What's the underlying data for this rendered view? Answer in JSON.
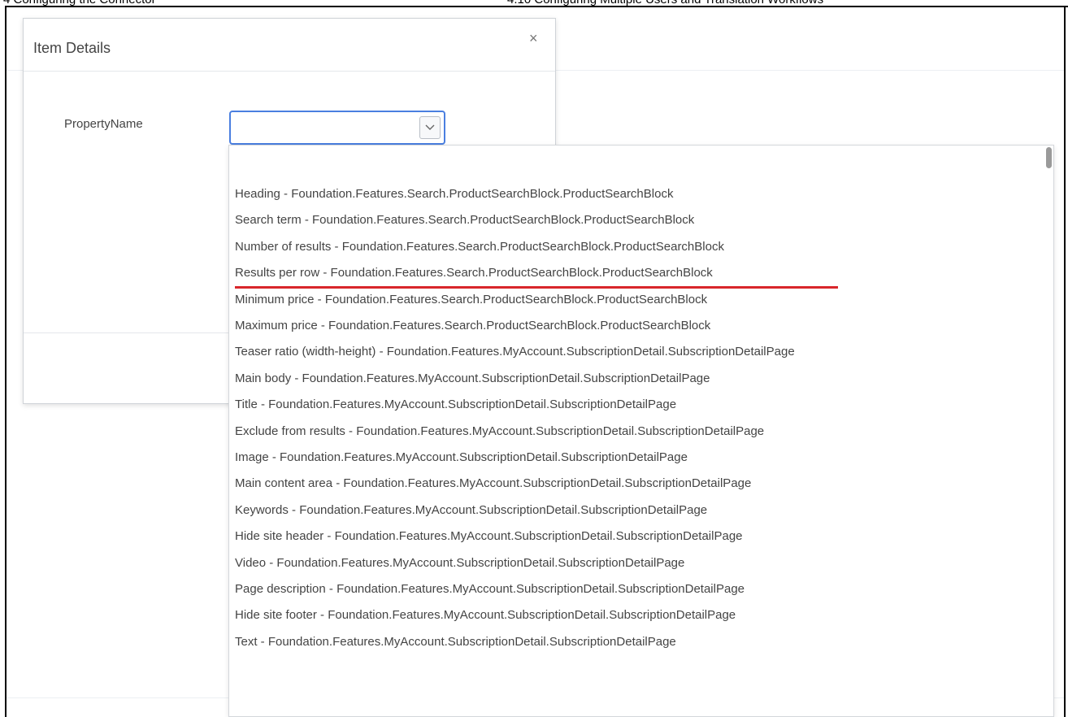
{
  "doc_header": {
    "left": "4 Configuring the Connector",
    "right": "4.10 Configuring Multiple Users and Translation Workflows"
  },
  "dialog": {
    "title": "Item Details",
    "close_glyph": "×",
    "field_label": "PropertyName",
    "select_value": ""
  },
  "dropdown": {
    "options": [
      "Heading - Foundation.Features.Search.ProductSearchBlock.ProductSearchBlock",
      "Search term - Foundation.Features.Search.ProductSearchBlock.ProductSearchBlock",
      "Number of results - Foundation.Features.Search.ProductSearchBlock.ProductSearchBlock",
      "Results per row - Foundation.Features.Search.ProductSearchBlock.ProductSearchBlock",
      "Minimum price - Foundation.Features.Search.ProductSearchBlock.ProductSearchBlock",
      "Maximum price - Foundation.Features.Search.ProductSearchBlock.ProductSearchBlock",
      "Teaser ratio (width-height) - Foundation.Features.MyAccount.SubscriptionDetail.SubscriptionDetailPage",
      "Main body - Foundation.Features.MyAccount.SubscriptionDetail.SubscriptionDetailPage",
      "Title - Foundation.Features.MyAccount.SubscriptionDetail.SubscriptionDetailPage",
      "Exclude from results - Foundation.Features.MyAccount.SubscriptionDetail.SubscriptionDetailPage",
      "Image - Foundation.Features.MyAccount.SubscriptionDetail.SubscriptionDetailPage",
      "Main content area - Foundation.Features.MyAccount.SubscriptionDetail.SubscriptionDetailPage",
      "Keywords - Foundation.Features.MyAccount.SubscriptionDetail.SubscriptionDetailPage",
      "Hide site header - Foundation.Features.MyAccount.SubscriptionDetail.SubscriptionDetailPage",
      "Video - Foundation.Features.MyAccount.SubscriptionDetail.SubscriptionDetailPage",
      "Page description - Foundation.Features.MyAccount.SubscriptionDetail.SubscriptionDetailPage",
      "Hide site footer - Foundation.Features.MyAccount.SubscriptionDetail.SubscriptionDetailPage",
      "Text - Foundation.Features.MyAccount.SubscriptionDetail.SubscriptionDetailPage"
    ],
    "highlighted_index": 3
  },
  "colors": {
    "highlight": "#d9262b",
    "focus_border": "#4a7fe0"
  },
  "icons": {
    "close": "close-icon",
    "dropdown_arrow": "chevron-down-icon"
  }
}
